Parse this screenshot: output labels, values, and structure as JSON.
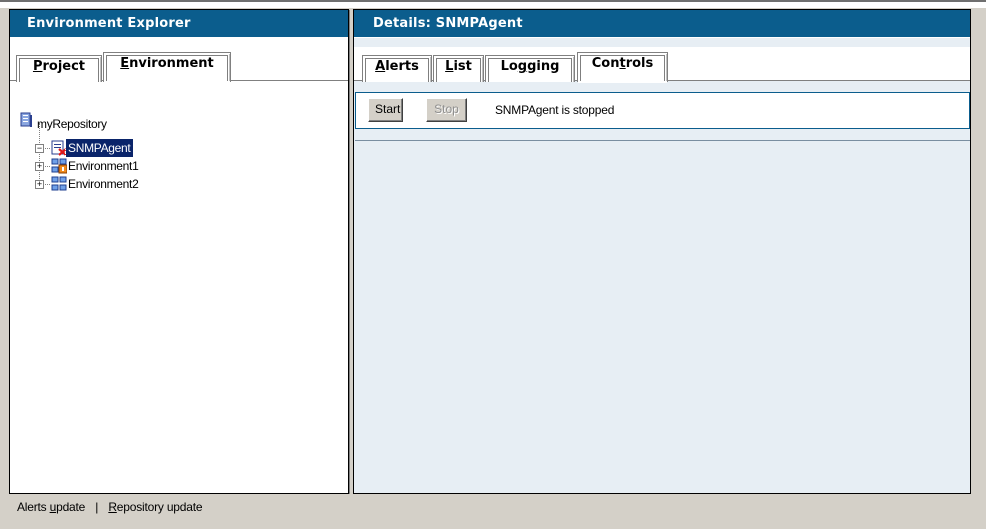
{
  "left_panel": {
    "title": "Environment Explorer",
    "tabs": [
      {
        "label_hot": "P",
        "label_rest": "roject",
        "active": false
      },
      {
        "label_hot": "E",
        "label_rest": "nvironment",
        "active": true
      }
    ],
    "tree": {
      "root": {
        "label": "myRepository",
        "icon": "repository-icon"
      },
      "items": [
        {
          "label": "SNMPAgent",
          "icon": "snmp-agent-stopped-icon",
          "expander": "−",
          "selected": true
        },
        {
          "label": "Environment1",
          "icon": "environment-warning-icon",
          "expander": "+",
          "selected": false
        },
        {
          "label": "Environment2",
          "icon": "environment-icon",
          "expander": "+",
          "selected": false
        }
      ]
    }
  },
  "right_panel": {
    "title": "Details: SNMPAgent",
    "tabs": [
      {
        "label_hot": "A",
        "label_rest": "lerts",
        "active": false
      },
      {
        "label_hot": "L",
        "label_rest": "ist",
        "active": false
      },
      {
        "label_pre": "Lo",
        "label_hot": "g",
        "label_rest": "ging",
        "active": false
      },
      {
        "label_pre": "Con",
        "label_hot": "t",
        "label_rest": "rols",
        "active": true
      }
    ],
    "controls": {
      "start_label": "Start",
      "stop_label": "Stop",
      "status_text": "SNMPAgent is stopped"
    }
  },
  "statusbar": {
    "alerts_pre": "Alerts ",
    "alerts_hot": "u",
    "alerts_rest": "pdate",
    "separator": "|",
    "repo_hot": "R",
    "repo_rest": "epository update"
  },
  "colors": {
    "title_bar": "#0b5d8d",
    "right_background": "#e7eef4",
    "selection": "#0a246a",
    "window_face": "#d4d0c8"
  }
}
